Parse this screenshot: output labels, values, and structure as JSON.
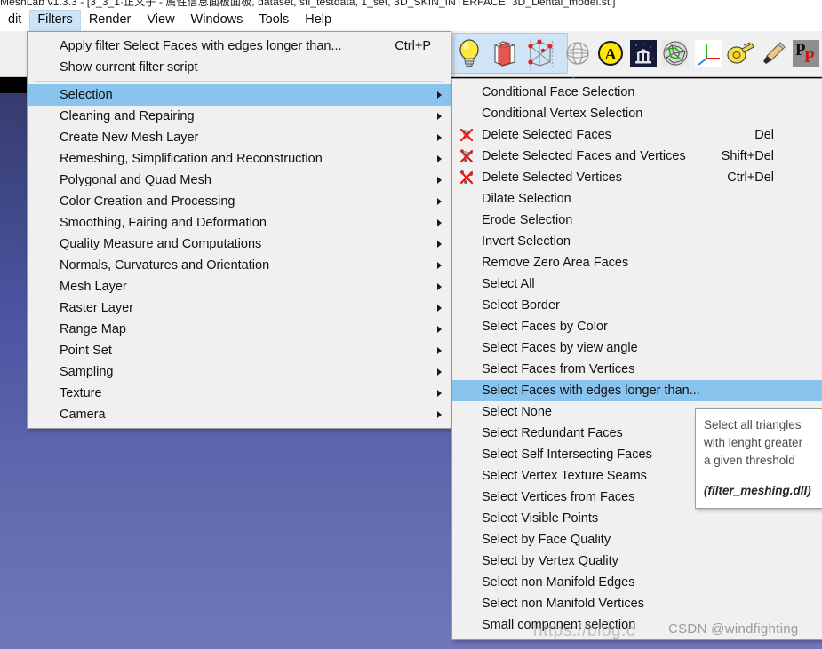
{
  "window": {
    "title": "MeshLab v1.3.3 - [3_3_1·正义子 - 属性信息面板面板, dataset, stl_testdata, 1_set, 3D_SKIN_INTERFACE, 3D_Dental_model.stl]"
  },
  "menubar": {
    "items": [
      {
        "label": "dit",
        "active": false
      },
      {
        "label": "Filters",
        "active": true
      },
      {
        "label": "Render",
        "active": false
      },
      {
        "label": "View",
        "active": false
      },
      {
        "label": "Windows",
        "active": false
      },
      {
        "label": "Tools",
        "active": false
      },
      {
        "label": "Help",
        "active": false
      }
    ]
  },
  "toolbar": {
    "groups": [
      {
        "name": "render-mode-group",
        "selected": true,
        "buttons": [
          {
            "icon": "lightbulb-icon",
            "label": "Toggle Lighting"
          },
          {
            "icon": "flat-shading-icon",
            "label": "Flat Shading"
          },
          {
            "icon": "points-wire-icon",
            "label": "Points and Wireframe"
          }
        ]
      },
      {
        "name": "tools-group",
        "selected": false,
        "buttons": [
          {
            "icon": "globe-wire-icon",
            "label": "Wireframe Sphere"
          },
          {
            "icon": "circle-a-icon",
            "label": "Toggle Text"
          },
          {
            "icon": "museum-icon",
            "label": "Render Scene"
          },
          {
            "icon": "mesh-ball-icon",
            "label": "Mesh Ball"
          },
          {
            "icon": "axis-icon",
            "label": "Show Axis"
          },
          {
            "icon": "measure-tape-icon",
            "label": "Measuring Tool"
          },
          {
            "icon": "paintbrush-icon",
            "label": "Paint Tool"
          },
          {
            "icon": "pp-icon",
            "label": "Pick Points"
          }
        ]
      }
    ]
  },
  "filters_menu": {
    "name": "Filters",
    "top_items": [
      {
        "label": "Apply filter Select Faces with edges longer than...",
        "shortcut": "Ctrl+P",
        "submenu": false
      },
      {
        "label": "Show current filter script",
        "shortcut": "",
        "submenu": false
      }
    ],
    "categories": [
      {
        "label": "Selection",
        "submenu": true,
        "highlighted": true
      },
      {
        "label": "Cleaning and Repairing",
        "submenu": true,
        "highlighted": false
      },
      {
        "label": "Create New Mesh Layer",
        "submenu": true,
        "highlighted": false
      },
      {
        "label": "Remeshing, Simplification and Reconstruction",
        "submenu": true,
        "highlighted": false
      },
      {
        "label": "Polygonal and Quad Mesh",
        "submenu": true,
        "highlighted": false
      },
      {
        "label": "Color Creation and Processing",
        "submenu": true,
        "highlighted": false
      },
      {
        "label": "Smoothing, Fairing and Deformation",
        "submenu": true,
        "highlighted": false
      },
      {
        "label": "Quality Measure and Computations",
        "submenu": true,
        "highlighted": false
      },
      {
        "label": "Normals, Curvatures and Orientation",
        "submenu": true,
        "highlighted": false
      },
      {
        "label": "Mesh Layer",
        "submenu": true,
        "highlighted": false
      },
      {
        "label": "Raster Layer",
        "submenu": true,
        "highlighted": false
      },
      {
        "label": "Range Map",
        "submenu": true,
        "highlighted": false
      },
      {
        "label": "Point Set",
        "submenu": true,
        "highlighted": false
      },
      {
        "label": "Sampling",
        "submenu": true,
        "highlighted": false
      },
      {
        "label": "Texture",
        "submenu": true,
        "highlighted": false
      },
      {
        "label": "Camera",
        "submenu": true,
        "highlighted": false
      }
    ]
  },
  "selection_submenu": {
    "name": "Selection",
    "items": [
      {
        "label": "Conditional Face Selection",
        "shortcut": "",
        "icon": "",
        "highlighted": false
      },
      {
        "label": "Conditional Vertex Selection",
        "shortcut": "",
        "icon": "",
        "highlighted": false
      },
      {
        "label": "Delete Selected Faces",
        "shortcut": "Del",
        "icon": "delete-faces-icon",
        "highlighted": false
      },
      {
        "label": "Delete Selected Faces and Vertices",
        "shortcut": "Shift+Del",
        "icon": "delete-faces-vertices-icon",
        "highlighted": false
      },
      {
        "label": "Delete Selected Vertices",
        "shortcut": "Ctrl+Del",
        "icon": "delete-vertices-icon",
        "highlighted": false
      },
      {
        "label": "Dilate Selection",
        "shortcut": "",
        "icon": "",
        "highlighted": false
      },
      {
        "label": "Erode Selection",
        "shortcut": "",
        "icon": "",
        "highlighted": false
      },
      {
        "label": "Invert Selection",
        "shortcut": "",
        "icon": "",
        "highlighted": false
      },
      {
        "label": "Remove Zero Area Faces",
        "shortcut": "",
        "icon": "",
        "highlighted": false
      },
      {
        "label": "Select All",
        "shortcut": "",
        "icon": "",
        "highlighted": false
      },
      {
        "label": "Select Border",
        "shortcut": "",
        "icon": "",
        "highlighted": false
      },
      {
        "label": "Select Faces by Color",
        "shortcut": "",
        "icon": "",
        "highlighted": false
      },
      {
        "label": "Select Faces by view angle",
        "shortcut": "",
        "icon": "",
        "highlighted": false
      },
      {
        "label": "Select Faces from Vertices",
        "shortcut": "",
        "icon": "",
        "highlighted": false
      },
      {
        "label": "Select Faces with edges longer than...",
        "shortcut": "",
        "icon": "",
        "highlighted": true
      },
      {
        "label": "Select None",
        "shortcut": "",
        "icon": "",
        "highlighted": false
      },
      {
        "label": "Select Redundant Faces",
        "shortcut": "",
        "icon": "",
        "highlighted": false
      },
      {
        "label": "Select Self Intersecting Faces",
        "shortcut": "",
        "icon": "",
        "highlighted": false
      },
      {
        "label": "Select Vertex Texture Seams",
        "shortcut": "",
        "icon": "",
        "highlighted": false
      },
      {
        "label": "Select Vertices from Faces",
        "shortcut": "",
        "icon": "",
        "highlighted": false
      },
      {
        "label": "Select Visible Points",
        "shortcut": "",
        "icon": "",
        "highlighted": false
      },
      {
        "label": "Select by Face Quality",
        "shortcut": "",
        "icon": "",
        "highlighted": false
      },
      {
        "label": "Select by Vertex Quality",
        "shortcut": "",
        "icon": "",
        "highlighted": false
      },
      {
        "label": "Select non Manifold Edges",
        "shortcut": "",
        "icon": "",
        "highlighted": false
      },
      {
        "label": "Select non Manifold Vertices",
        "shortcut": "",
        "icon": "",
        "highlighted": false
      },
      {
        "label": "Small component selection",
        "shortcut": "",
        "icon": "",
        "highlighted": false
      }
    ]
  },
  "tooltip": {
    "line1": "Select all triangles",
    "line2": "with lenght greater",
    "line3": "a given threshold",
    "plugin": "(filter_meshing.dll)"
  },
  "watermark": {
    "url": "https://blog.c",
    "author": "CSDN @windfighting"
  },
  "colors": {
    "menu_bg": "#f0f0f0",
    "menu_highlight": "#88c4ee",
    "menubar_active": "#cce4f7",
    "toolbar_bg": "#f0f0f0",
    "toolbar_selected": "#cfe4f7",
    "viewport_top": "#353c6e",
    "viewport_bottom": "#7077bb",
    "mesh_pink": "#d89287",
    "axis_red": "#ff1a1a",
    "axis_green": "#20e020",
    "axis_blue": "#1430ff",
    "tooltip_bg": "#ffffff"
  }
}
